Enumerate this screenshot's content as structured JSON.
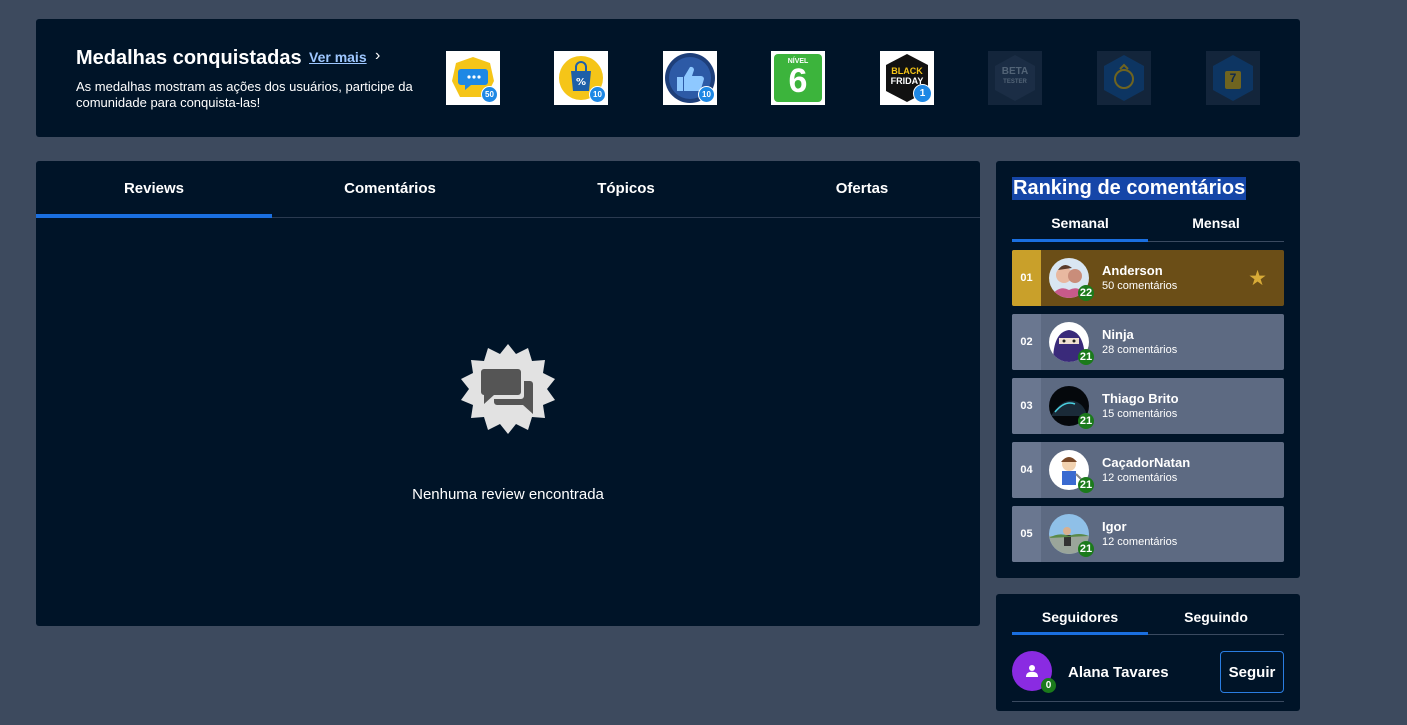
{
  "medals": {
    "title": "Medalhas conquistadas",
    "see_more": "Ver mais",
    "description": "As medalhas mostram as ações dos usuários, participe da comunidade para conquista-las!",
    "items": [
      {
        "name": "comment-medal",
        "count": "50"
      },
      {
        "name": "offer-medal",
        "count": "10"
      },
      {
        "name": "like-medal",
        "count": "10"
      },
      {
        "name": "level-medal",
        "label_top": "NÍVEL",
        "label_num": "6"
      },
      {
        "name": "black-friday-medal",
        "label_top": "BLACK",
        "label_bottom": "FRIDAY",
        "count": "1"
      },
      {
        "name": "beta-tester-medal",
        "label_top": "BETA",
        "label_bottom": "TESTER"
      },
      {
        "name": "locked-medal-1"
      },
      {
        "name": "locked-medal-2",
        "label_num": "7"
      }
    ]
  },
  "content_tabs": {
    "items": [
      "Reviews",
      "Comentários",
      "Tópicos",
      "Ofertas"
    ],
    "active": "Reviews"
  },
  "empty_state": {
    "message": "Nenhuma review encontrada",
    "icon": "forum-icon"
  },
  "ranking": {
    "title": "Ranking de comentários",
    "tabs": [
      "Semanal",
      "Mensal"
    ],
    "active_tab": "Semanal",
    "rows": [
      {
        "rank": "01",
        "name": "Anderson",
        "comments": "50 comentários",
        "level": "22",
        "colors": {
          "accent": "#c9a02a"
        }
      },
      {
        "rank": "02",
        "name": "Ninja",
        "comments": "28 comentários",
        "level": "21"
      },
      {
        "rank": "03",
        "name": "Thiago Brito",
        "comments": "15 comentários",
        "level": "21"
      },
      {
        "rank": "04",
        "name": "CaçadorNatan",
        "comments": "12 comentários",
        "level": "21"
      },
      {
        "rank": "05",
        "name": "Igor",
        "comments": "12 comentários",
        "level": "21"
      }
    ]
  },
  "follow": {
    "tabs": [
      "Seguidores",
      "Seguindo"
    ],
    "active_tab": "Seguidores",
    "user": {
      "name": "Alana Tavares",
      "level": "0"
    },
    "button": "Seguir"
  },
  "colors": {
    "page_bg": "#3d4a5e",
    "card_bg": "#001428",
    "accent_blue": "#1a6fe0",
    "gold": "#c9a02a",
    "level_green": "#1b7a1b"
  }
}
